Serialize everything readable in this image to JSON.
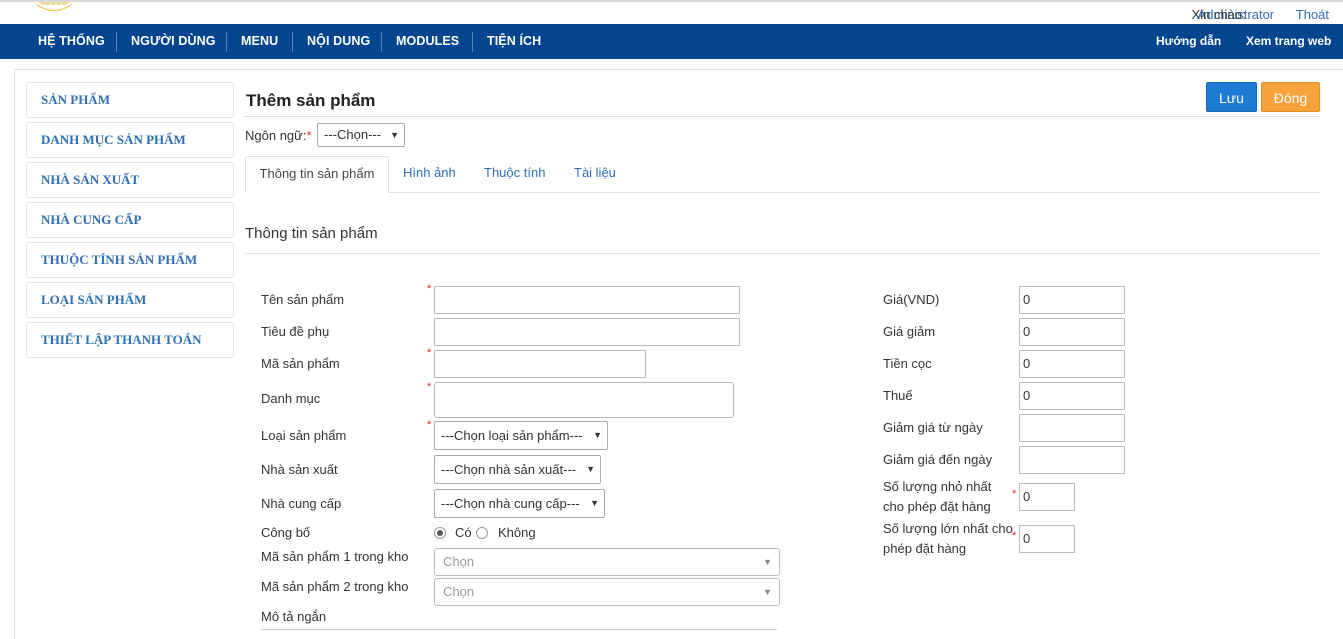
{
  "header": {
    "greeting_label": "Xin chào:",
    "user": "Administrator",
    "logout": "Thoát"
  },
  "nav": {
    "items": [
      "HỆ THỐNG",
      "NGƯỜI DÙNG",
      "MENU",
      "NỘI DUNG",
      "MODULES",
      "TIỆN ÍCH"
    ],
    "help": "Hướng dẫn",
    "view_site": "Xem trang web"
  },
  "sidebar": {
    "items": [
      "SẢN PHẨM",
      "DANH MỤC SẢN PHẨM",
      "NHÀ SẢN XUẤT",
      "NHÀ CUNG CẤP",
      "THUỘC TÍNH SẢN PHẨM",
      "LOẠI SẢN PHẨM",
      "THIẾT LẬP THANH TOÁN"
    ]
  },
  "page": {
    "title": "Thêm sản phẩm",
    "save": "Lưu",
    "close": "Đóng",
    "language_label": "Ngôn ngữ:",
    "language_value": "---Chọn---",
    "tabs": [
      "Thông tin sản phẩm",
      "Hình ảnh",
      "Thuộc tính",
      "Tài liệu"
    ],
    "section_title": "Thông tin sản phẩm"
  },
  "form_left": {
    "product_name": "Tên sản phẩm",
    "subtitle": "Tiêu đề phụ",
    "product_code": "Mã sản phẩm",
    "category": "Danh mục",
    "product_type": "Loại sản phẩm",
    "product_type_value": "---Chọn loại sản phẩm---",
    "manufacturer": "Nhà sản xuất",
    "manufacturer_value": "---Chọn nhà sản xuất---",
    "supplier": "Nhà cung cấp",
    "supplier_value": "---Chọn nhà cung cấp---",
    "publish": "Công bố",
    "publish_yes": "Có",
    "publish_no": "Không",
    "stock_code_1": "Mã sản phẩm 1 trong kho",
    "stock_code_1_value": "Chọn",
    "stock_code_2": "Mã sản phẩm 2 trong kho",
    "stock_code_2_value": "Chọn",
    "short_desc": "Mô tả ngắn"
  },
  "form_right": {
    "price": "Giá(VND)",
    "price_value": "0",
    "discount_price": "Giá giảm",
    "discount_price_value": "0",
    "deposit": "Tiền cọc",
    "deposit_value": "0",
    "tax": "Thuế",
    "tax_value": "0",
    "discount_from": "Giảm giá từ ngày",
    "discount_to": "Giảm giá đến ngày",
    "min_qty_line1": "Số lượng nhỏ nhất",
    "min_qty_line2": "cho phép đặt hàng",
    "min_qty_value": "0",
    "max_qty_line1": "Số lượng lớn nhất cho",
    "max_qty_line2": "phép đặt hàng",
    "max_qty_value": "0"
  },
  "colors": {
    "nav_bg": "#03468f",
    "link": "#2f6fb2",
    "save_btn": "#1d7bd4",
    "close_btn": "#f6a33b",
    "required": "#d9302a"
  }
}
